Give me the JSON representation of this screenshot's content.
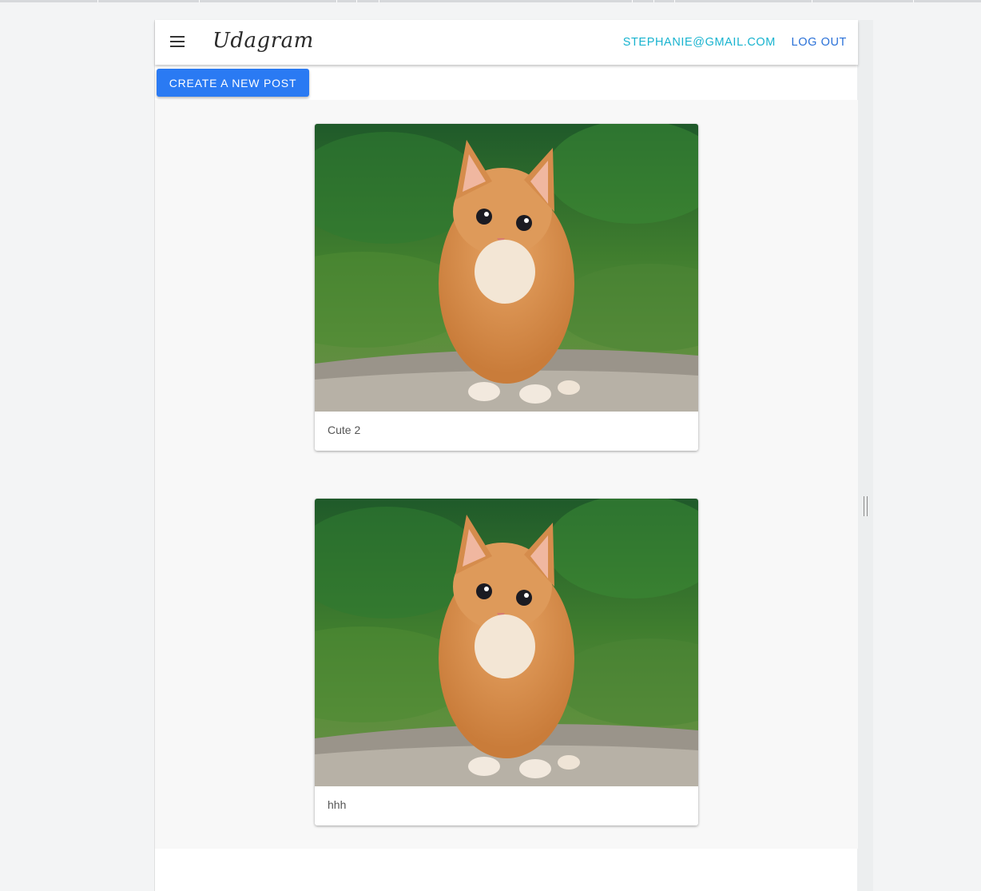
{
  "app": {
    "brand": "Udagram",
    "menu_icon": "menu-icon"
  },
  "header": {
    "user_email": "STEPHANIE@GMAIL.COM",
    "logout_label": "LOG OUT"
  },
  "actions": {
    "create_post_label": "CREATE A NEW POST"
  },
  "feed": {
    "posts": [
      {
        "image": "orange-kitten-photo",
        "caption": "Cute 2"
      },
      {
        "image": "orange-kitten-photo",
        "caption": "hhh"
      }
    ]
  },
  "colors": {
    "accent_cyan": "#17b3cf",
    "accent_blue": "#2a71d8",
    "button_blue": "#2a7af3"
  }
}
